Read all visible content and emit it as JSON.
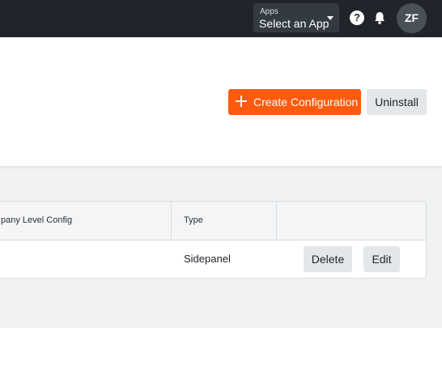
{
  "topbar": {
    "app_selector": {
      "caption": "Apps",
      "value": "Select an App"
    },
    "help_glyph": "?",
    "avatar_initials": "ZF"
  },
  "header": {
    "create_button_label": "Create Configuration",
    "uninstall_button_label": "Uninstall"
  },
  "table": {
    "columns": [
      "pany Level Config",
      "Type",
      ""
    ],
    "rows": [
      {
        "level_config": "",
        "type": "Sidepanel",
        "actions": [
          "Delete",
          "Edit"
        ]
      }
    ]
  },
  "colors": {
    "topbar": "#21252b",
    "accent": "#ff5a0d",
    "secondary_button": "#e4e7ea",
    "content_background": "#f1f2f3"
  }
}
